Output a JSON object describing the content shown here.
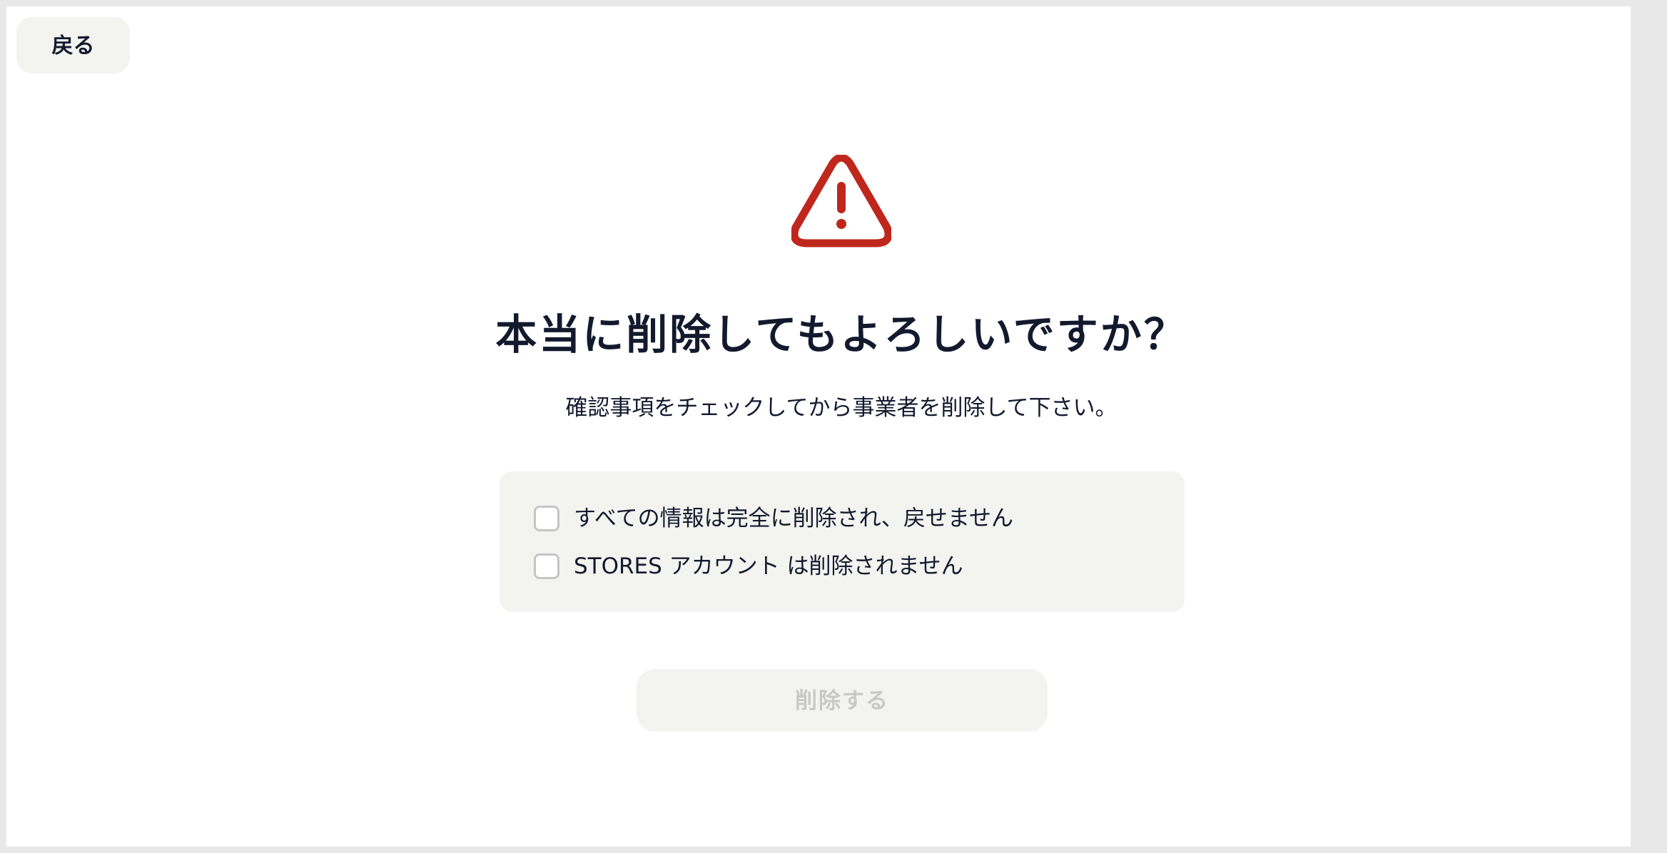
{
  "header": {
    "back_label": "戻る"
  },
  "dialog": {
    "title": "本当に削除してもよろしいですか？",
    "description": "確認事項をチェックしてから事業者を削除して下さい。",
    "checklist": [
      {
        "label": "すべての情報は完全に削除され、戻せません",
        "checked": false
      },
      {
        "label": "STORES アカウント は削除されません",
        "checked": false
      }
    ],
    "delete_label": "削除する",
    "delete_enabled": false
  },
  "colors": {
    "warning": "#c0271c",
    "text": "#131a2e",
    "panel": "#f3f3ef",
    "disabled_text": "#c8c8c4",
    "checkbox_border": "#c5c5c2"
  },
  "icons": {
    "warning": "warning-triangle-icon"
  }
}
